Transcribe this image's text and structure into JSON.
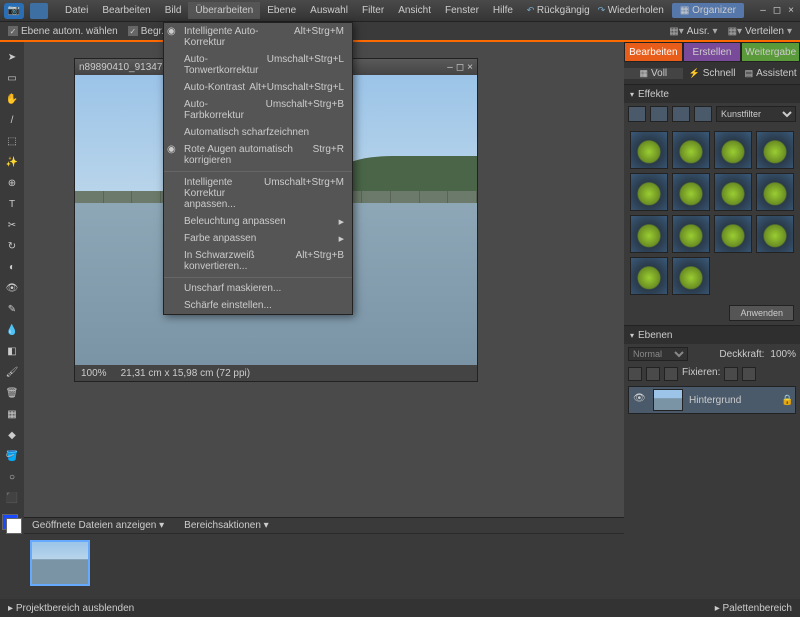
{
  "menubar": [
    "Datei",
    "Bearbeiten",
    "Bild",
    "Überarbeiten",
    "Ebene",
    "Auswahl",
    "Filter",
    "Ansicht",
    "Fenster",
    "Hilfe"
  ],
  "titlebar": {
    "undo": "Rückgängig",
    "redo": "Wiederholen",
    "organizer": "Organizer"
  },
  "toolbar2": {
    "opt1": "Ebene autom. wählen",
    "opt2": "Begr.rahmen einbl.",
    "ausr": "Ausr.",
    "verteilen": "Verteilen"
  },
  "dropdown": [
    {
      "label": "Intelligente Auto-Korrektur",
      "shortcut": "Alt+Strg+M",
      "icon": true
    },
    {
      "label": "Auto-Tonwertkorrektur",
      "shortcut": "Umschalt+Strg+L"
    },
    {
      "label": "Auto-Kontrast",
      "shortcut": "Alt+Umschalt+Strg+L"
    },
    {
      "label": "Auto-Farbkorrektur",
      "shortcut": "Umschalt+Strg+B"
    },
    {
      "label": "Automatisch scharfzeichnen"
    },
    {
      "label": "Rote Augen automatisch korrigieren",
      "shortcut": "Strg+R",
      "icon": true
    },
    {
      "sep": true
    },
    {
      "label": "Intelligente Korrektur anpassen...",
      "shortcut": "Umschalt+Strg+M"
    },
    {
      "label": "Beleuchtung anpassen",
      "sub": true
    },
    {
      "label": "Farbe anpassen",
      "sub": true
    },
    {
      "label": "In Schwarzweiß konvertieren...",
      "shortcut": "Alt+Strg+B"
    },
    {
      "sep": true
    },
    {
      "label": "Unscharf maskieren..."
    },
    {
      "label": "Schärfe einstellen..."
    }
  ],
  "imagewindow": {
    "title": "n89890410_913475_9176...",
    "zoom": "100%",
    "dims": "21,31 cm x 15,98 cm (72 ppi)"
  },
  "projectbar": {
    "open": "Geöffnete Dateien anzeigen",
    "actions": "Bereichsaktionen"
  },
  "footer": {
    "left": "Projektbereich ausblenden",
    "right": "Palettenbereich"
  },
  "tabs": {
    "edit": "Bearbeiten",
    "create": "Erstellen",
    "share": "Weitergabe"
  },
  "subtabs": {
    "full": "Voll",
    "quick": "Schnell",
    "assist": "Assistent"
  },
  "effects": {
    "title": "Effekte",
    "filter": "Kunstfilter",
    "apply": "Anwenden"
  },
  "layers": {
    "title": "Ebenen",
    "mode": "Normal",
    "opacity_label": "Deckkraft:",
    "opacity": "100%",
    "lock": "Fixieren:",
    "bg": "Hintergrund"
  },
  "tools": [
    "➤",
    "▭",
    "✋",
    "/",
    "⬚",
    "✨",
    "⊕",
    "T",
    "✂",
    "↻",
    "◐",
    "👁",
    "✎",
    "💧",
    "◧",
    "🖌",
    "🗑",
    "▦",
    "◆",
    "🪣",
    "○",
    "⬛"
  ],
  "colors": {
    "fg": "#1a4aff",
    "bg": "#ffffff"
  }
}
